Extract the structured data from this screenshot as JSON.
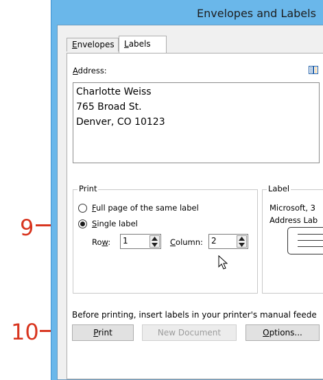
{
  "window": {
    "title": "Envelopes and Labels"
  },
  "tabs": [
    {
      "label": "Envelopes",
      "underline_char": "E"
    },
    {
      "label": "Labels",
      "underline_char": "L"
    }
  ],
  "address": {
    "label": "Address:",
    "lines": [
      "Charlotte Weiss",
      "765 Broad St.",
      "Denver, CO 10123"
    ]
  },
  "print_group": {
    "title": "Print",
    "full_page_label": "Full page of the same label",
    "single_label_label": "Single label",
    "selected": "single_label",
    "row_label": "Row:",
    "row_value": "1",
    "column_label": "Column:",
    "column_value": "2"
  },
  "label_group": {
    "title": "Label",
    "vendor_text": "Microsoft, 3",
    "product_text": "Address Lab"
  },
  "hint": "Before printing, insert labels in your printer's manual feede",
  "buttons": {
    "print": "Print",
    "new_document": "New Document",
    "options": "Options..."
  },
  "callouts": [
    "9",
    "10"
  ],
  "colors": {
    "title_bar": "#6ab7ea",
    "callout": "#d8351f"
  }
}
